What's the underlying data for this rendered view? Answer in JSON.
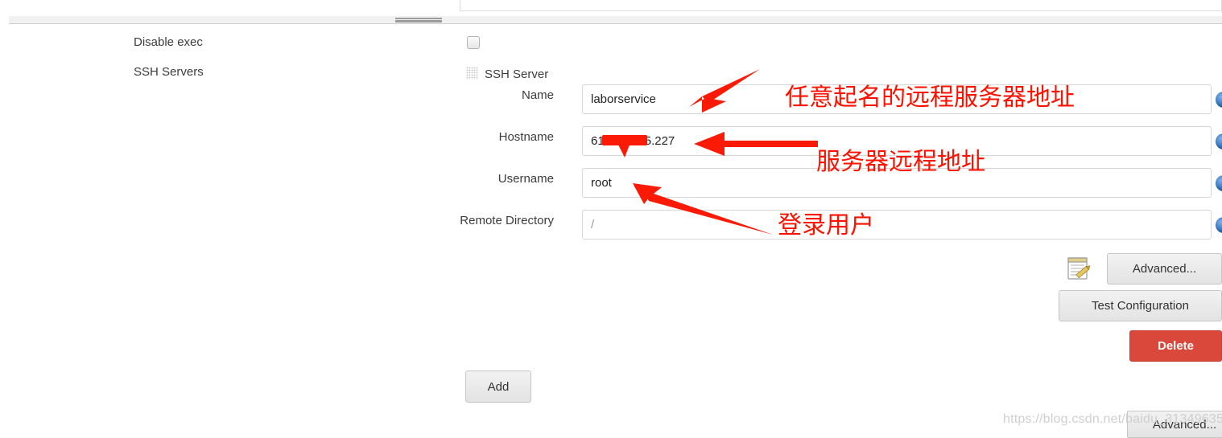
{
  "left_nav": {
    "items": [
      {
        "label": "Disable exec"
      },
      {
        "label": "SSH Servers"
      }
    ]
  },
  "form": {
    "section_title": "SSH Server",
    "enabled_checkbox_label": "",
    "fields": [
      {
        "label": "Name",
        "value": "laborservice",
        "placeholder": ""
      },
      {
        "label": "Hostname",
        "value": "61.152.225.227",
        "placeholder": ""
      },
      {
        "label": "Username",
        "value": "root",
        "placeholder": ""
      },
      {
        "label": "Remote Directory",
        "value": "",
        "placeholder": "/"
      }
    ]
  },
  "buttons": {
    "advanced": "Advanced...",
    "test_configuration": "Test Configuration",
    "delete": "Delete",
    "add": "Add",
    "advanced_bottom": "Advanced..."
  },
  "annotations": [
    {
      "text": "任意起名的远程服务器地址"
    },
    {
      "text": "服务器远程地址"
    },
    {
      "text": "登录用户"
    }
  ],
  "watermark": "https://blog.csdn.net/baidu_31349635",
  "colors": {
    "annotation_red": "#ff1100",
    "delete_red": "#d9483b",
    "text": "#3c3c3c"
  }
}
